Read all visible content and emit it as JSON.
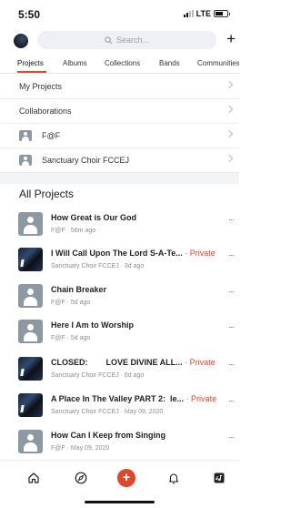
{
  "status_bar": {
    "time": "5:50",
    "network": "LTE"
  },
  "search": {
    "placeholder": "Search..."
  },
  "tabs": [
    {
      "label": "Projects",
      "active": true
    },
    {
      "label": "Albums"
    },
    {
      "label": "Collections"
    },
    {
      "label": "Bands"
    },
    {
      "label": "Communities"
    }
  ],
  "menu": {
    "my_projects": "My Projects",
    "collaborations": "Collaborations",
    "groups": [
      {
        "label": "F@F"
      },
      {
        "label": "Sanctuary Choir FCCEJ"
      }
    ]
  },
  "all_projects": {
    "title": "All Projects",
    "items": [
      {
        "title": "How Great is Our God",
        "privacy": "",
        "meta": "F@F · 56m ago"
      },
      {
        "title": "I Will Call Upon The Lord S-A-Te...",
        "privacy": " · Private",
        "meta": "Sanctuary Choir FCCEJ · 3d ago"
      },
      {
        "title": "Chain Breaker",
        "privacy": "",
        "meta": "F@F · 5d ago"
      },
      {
        "title": "Here I Am to Worship",
        "privacy": "",
        "meta": "F@F · 5d ago"
      },
      {
        "title": "CLOSED:        LOVE DIVINE ALL...",
        "privacy": " · Private",
        "meta": "Sanctuary Choir FCCEJ · 6d ago"
      },
      {
        "title": "A Place In The Valley PART 2:  le...",
        "privacy": " · Private",
        "meta": "Sanctuary Choir FCCEJ · May 09, 2020"
      },
      {
        "title": "How Can I Keep from Singing",
        "privacy": "",
        "meta": "F@F · May 09, 2020"
      }
    ]
  },
  "more_label": "...",
  "bottom_nav": [
    {
      "icon": "home-icon"
    },
    {
      "icon": "compass-icon"
    },
    {
      "icon": "plus-icon"
    },
    {
      "icon": "bell-icon"
    },
    {
      "icon": "music-library-icon"
    }
  ],
  "colors": {
    "accent": "#e0452d",
    "muted": "#8a8f96"
  }
}
